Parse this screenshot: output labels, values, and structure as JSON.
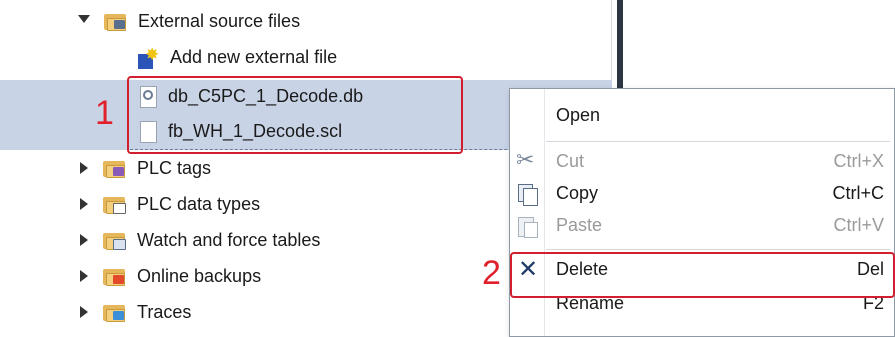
{
  "tree": {
    "items": [
      {
        "label": "External source files",
        "icon": "folder-icon"
      },
      {
        "label": "Add new external file",
        "icon": "add-file-icon"
      },
      {
        "label": "db_C5PC_1_Decode.db",
        "icon": "db-file-icon"
      },
      {
        "label": "fb_WH_1_Decode.scl",
        "icon": "scl-file-icon"
      },
      {
        "label": "PLC tags",
        "icon": "folder-tags-icon"
      },
      {
        "label": "PLC data types",
        "icon": "folder-datatypes-icon"
      },
      {
        "label": "Watch and force tables",
        "icon": "folder-watch-icon"
      },
      {
        "label": "Online backups",
        "icon": "folder-backups-icon"
      },
      {
        "label": "Traces",
        "icon": "folder-traces-icon"
      }
    ]
  },
  "annotations": {
    "first": "1",
    "second": "2"
  },
  "context_menu": {
    "items": [
      {
        "label": "Open",
        "shortcut": "",
        "enabled": true
      },
      {
        "label": "Cut",
        "shortcut": "Ctrl+X",
        "enabled": false
      },
      {
        "label": "Copy",
        "shortcut": "Ctrl+C",
        "enabled": true
      },
      {
        "label": "Paste",
        "shortcut": "Ctrl+V",
        "enabled": false
      },
      {
        "label": "Delete",
        "shortcut": "Del",
        "enabled": true
      },
      {
        "label": "Rename",
        "shortcut": "F2",
        "enabled": true
      }
    ]
  },
  "colors": {
    "selection": "#c9d3e6",
    "annotation": "#d21f2f",
    "folder": "#f4d07e"
  }
}
